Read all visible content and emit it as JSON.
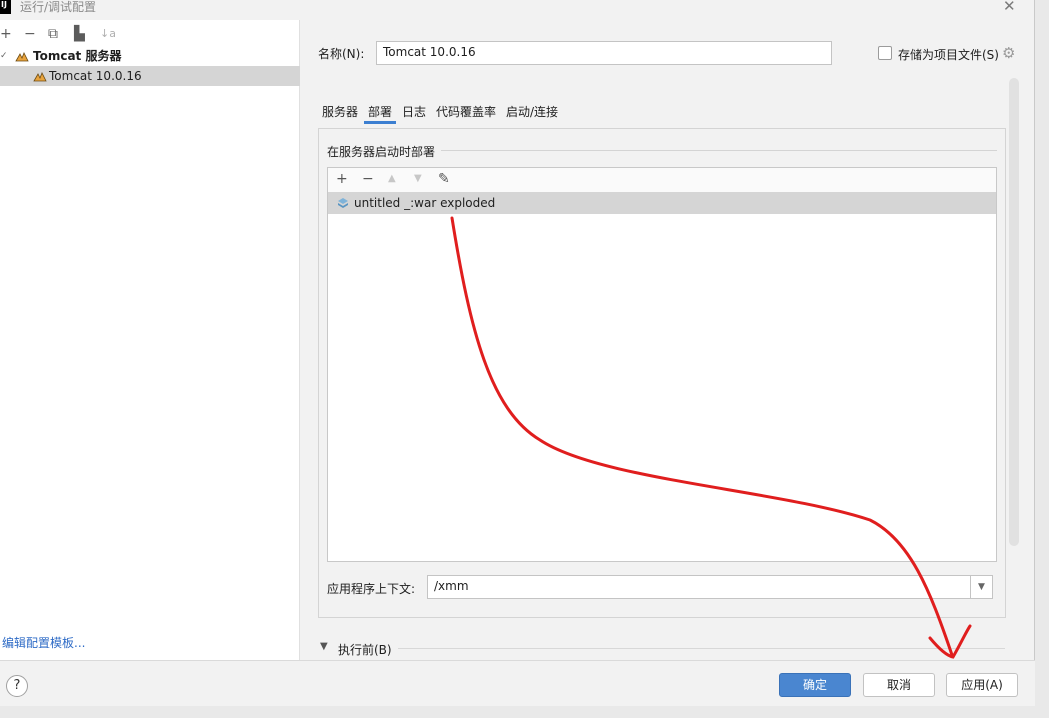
{
  "window": {
    "app_logo": "IJ",
    "title": "运行/调试配置",
    "close_glyph": "✕"
  },
  "left_toolbar": {
    "add": "+",
    "remove": "−",
    "copy": "⧉",
    "folder": "▙",
    "sort": "↓a"
  },
  "tree": {
    "group_label": "Tomcat 服务器",
    "items": [
      {
        "label": "Tomcat 10.0.16"
      }
    ]
  },
  "edit_templates_link": "编辑配置模板...",
  "form": {
    "name_label": "名称(N):",
    "name_value": "Tomcat 10.0.16",
    "store_as_project_file": "存储为项目文件(S)",
    "store_checked": false
  },
  "tabs": [
    {
      "label": "服务器"
    },
    {
      "label": "部署"
    },
    {
      "label": "日志"
    },
    {
      "label": "代码覆盖率"
    },
    {
      "label": "启动/连接"
    }
  ],
  "active_tab": "部署",
  "deployment": {
    "section_title": "在服务器启动时部署",
    "toolbar": {
      "add": "+",
      "remove": "−",
      "up": "▲",
      "down": "▼",
      "edit": "✎"
    },
    "artifacts": [
      {
        "label": "untitled _:war exploded"
      }
    ],
    "context_label": "应用程序上下文:",
    "context_value": "/xmm"
  },
  "before_launch_label": "执行前(B)",
  "footer": {
    "help": "?",
    "ok": "确定",
    "cancel": "取消",
    "apply": "应用(A)"
  },
  "colors": {
    "primary_button": "#4a86d0",
    "active_tab_underline": "#3c7fd1",
    "link": "#2e6bc6",
    "selection": "#d5d5d5",
    "annotation_stroke": "#e01e1e"
  }
}
